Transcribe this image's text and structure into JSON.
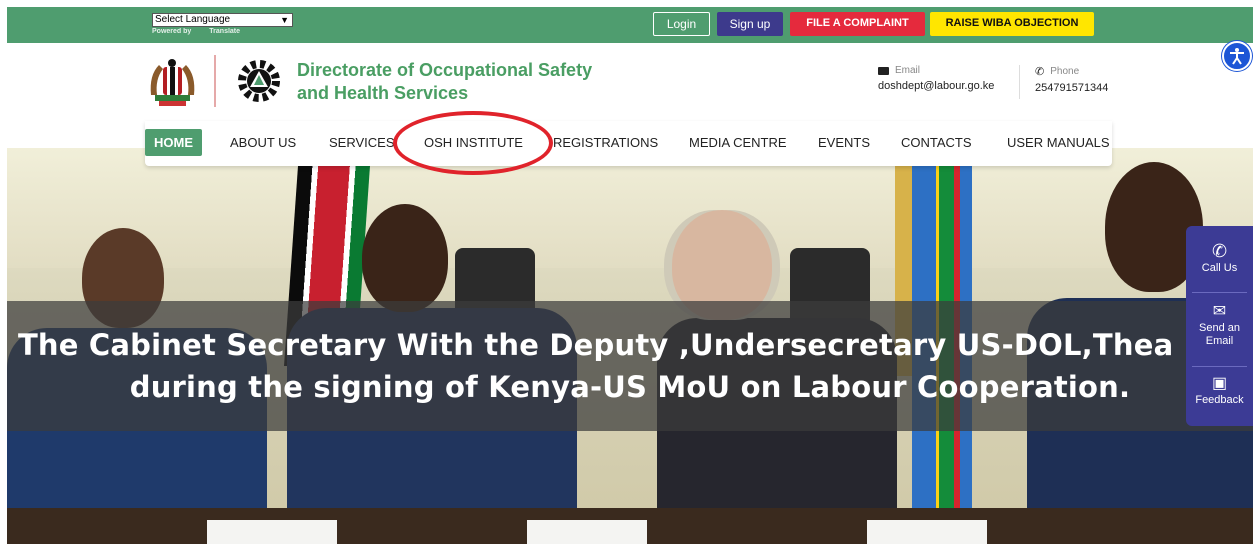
{
  "topbar": {
    "language_select": "Select Language",
    "powered_by": "Powered by",
    "translate": "Translate",
    "login": "Login",
    "signup": "Sign up",
    "complaint": "FILE A COMPLAINT",
    "wiba": "RAISE WIBA OBJECTION"
  },
  "header": {
    "org_line1": "Directorate of Occupational Safety",
    "org_line2": "and Health Services",
    "email_label": "Email",
    "email_value": "doshdept@labour.go.ke",
    "phone_label": "Phone",
    "phone_value": "254791571344"
  },
  "nav": {
    "items": [
      {
        "label": "HOME"
      },
      {
        "label": "ABOUT US"
      },
      {
        "label": "SERVICES"
      },
      {
        "label": "OSH INSTITUTE"
      },
      {
        "label": "REGISTRATIONS"
      },
      {
        "label": "MEDIA CENTRE"
      },
      {
        "label": "EVENTS"
      },
      {
        "label": "CONTACTS"
      },
      {
        "label": "USER MANUALS"
      }
    ]
  },
  "hero": {
    "caption_line1": "The Cabinet Secretary With the Deputy ,Undersecretary US-DOL,Thea Lee",
    "caption_line2": "during the signing of Kenya-US MoU on Labour Cooperation."
  },
  "sidefloat": {
    "call": "Call Us",
    "email_line1": "Send an",
    "email_line2": "Email",
    "feedback": "Feedback"
  },
  "colors": {
    "green": "#4f9d6f",
    "navy": "#3d3a8c",
    "red": "#e52a3d",
    "yellow": "#ffe600",
    "annotation": "#e0232b"
  }
}
